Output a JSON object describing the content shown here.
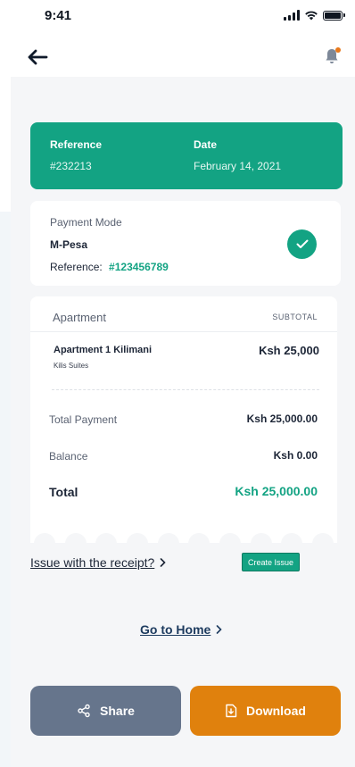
{
  "status_bar": {
    "time": "9:41"
  },
  "reference_card": {
    "reference_label": "Reference",
    "reference_value": "#232213",
    "date_label": "Date",
    "date_value": "February 14, 2021"
  },
  "payment": {
    "mode_label": "Payment Mode",
    "mode_value": "M-Pesa",
    "reference_label": "Reference:",
    "reference_value": "#123456789"
  },
  "receipt": {
    "header_left": "Apartment",
    "header_right": "SUBTOTAL",
    "item_name": "Apartment 1 Kilimani",
    "item_sub": "Kilis Suites",
    "item_price": "Ksh 25,000",
    "total_payment_label": "Total Payment",
    "total_payment_value": "Ksh 25,000.00",
    "balance_label": "Balance",
    "balance_value": "Ksh 0.00",
    "total_label": "Total",
    "total_value": "Ksh 25,000.00"
  },
  "issue": {
    "link_text": "Issue with the receipt?",
    "button_label": "Create Issue"
  },
  "home": {
    "link_text": "Go to Home"
  },
  "buttons": {
    "share": "Share",
    "download": "Download"
  },
  "colors": {
    "accent": "#13a383",
    "share": "#66758c",
    "download": "#e0810d"
  }
}
